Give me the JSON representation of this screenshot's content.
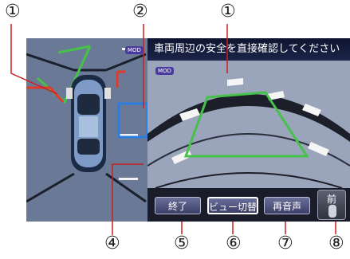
{
  "callouts": {
    "top_left": "①",
    "top_middle": "②",
    "top_right": "①",
    "bottom": [
      "④",
      "⑤",
      "⑥",
      "⑦",
      "⑧"
    ]
  },
  "screen": {
    "message": "車両周辺の安全を直接確認してください",
    "mod_badge_rear": "MOD",
    "mod_badge_top": "MOD",
    "guide_line_color": "#46c24a",
    "warning_line_color": "#e23a2a",
    "sonar_color": "#2b7de0"
  },
  "buttons": {
    "end": "終了",
    "view_switch": "ビュー切替",
    "replay_voice": "再音声",
    "front_view": "前"
  }
}
